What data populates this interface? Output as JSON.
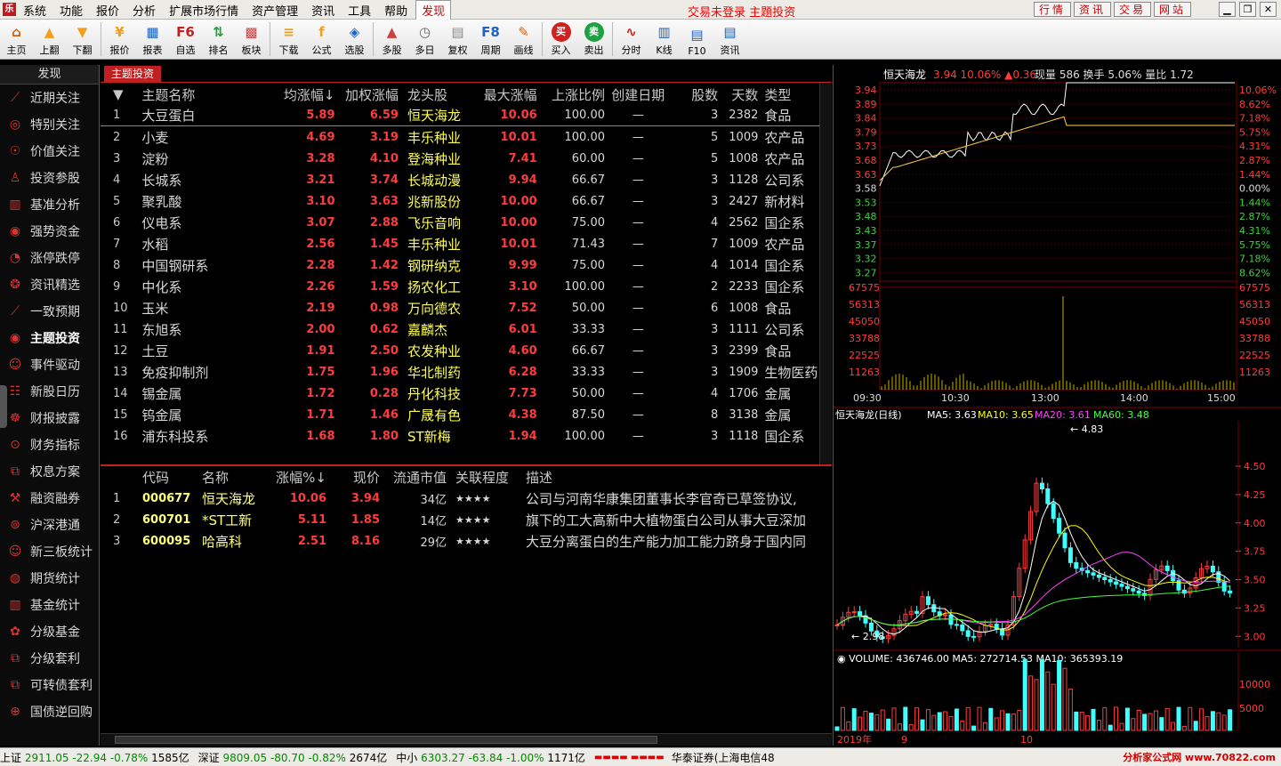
{
  "menubar": {
    "logo": "乐",
    "menus": [
      "系统",
      "功能",
      "报价",
      "分析",
      "扩展市场行情",
      "资产管理",
      "资讯",
      "工具",
      "帮助",
      "发现"
    ],
    "active_menu": "发现",
    "status": "交易未登录 主题投资",
    "quick": [
      "行情",
      "资讯",
      "交易",
      "网站"
    ]
  },
  "toolbar": [
    {
      "label": "主页",
      "icon": "home-icon",
      "color": "#d06010"
    },
    {
      "label": "上翻",
      "icon": "arrow-up-icon",
      "color": "#f0a020"
    },
    {
      "label": "下翻",
      "icon": "arrow-down-icon",
      "color": "#f0a020"
    },
    {
      "sep": true
    },
    {
      "label": "报价",
      "icon": "quote-icon",
      "color": "#f0a020"
    },
    {
      "label": "报表",
      "icon": "report-icon",
      "color": "#2060c0"
    },
    {
      "label": "自选",
      "icon": "f6-icon",
      "color": "#c02020"
    },
    {
      "label": "排名",
      "icon": "rank-icon",
      "color": "#20a040"
    },
    {
      "label": "板块",
      "icon": "sector-icon",
      "color": "#d04040"
    },
    {
      "sep": true
    },
    {
      "label": "下载",
      "icon": "download-icon",
      "color": "#f0a020"
    },
    {
      "label": "公式",
      "icon": "formula-icon",
      "color": "#f0a020"
    },
    {
      "label": "选股",
      "icon": "stock-pick-icon",
      "color": "#2060c0"
    },
    {
      "sep": true
    },
    {
      "label": "多股",
      "icon": "multi-stock-icon",
      "color": "#d04040"
    },
    {
      "label": "多日",
      "icon": "multi-day-icon",
      "color": "#666"
    },
    {
      "label": "复权",
      "icon": "adjust-icon",
      "color": "#888"
    },
    {
      "label": "周期",
      "icon": "f8-icon",
      "color": "#2060c0"
    },
    {
      "label": "画线",
      "icon": "draw-line-icon",
      "color": "#d06010"
    },
    {
      "sep": true
    },
    {
      "label": "买入",
      "icon": "buy-icon",
      "color": "#d02020"
    },
    {
      "label": "卖出",
      "icon": "sell-icon",
      "color": "#20a040"
    },
    {
      "sep": true
    },
    {
      "label": "分时",
      "icon": "timeshare-icon",
      "color": "#d02020"
    },
    {
      "label": "K线",
      "icon": "kline-icon",
      "color": "#2060c0"
    },
    {
      "label": "F10",
      "icon": "f10-icon",
      "color": "#2060c0"
    },
    {
      "label": "资讯",
      "icon": "news-icon",
      "color": "#2060c0"
    }
  ],
  "sidebar": {
    "title": "发现",
    "items": [
      {
        "label": "近期关注",
        "icon": "trend-icon"
      },
      {
        "label": "特别关注",
        "icon": "target-icon"
      },
      {
        "label": "价值关注",
        "icon": "value-icon"
      },
      {
        "label": "投资参股",
        "icon": "invest-icon"
      },
      {
        "label": "基准分析",
        "icon": "bar-chart-icon"
      },
      {
        "label": "强势资金",
        "icon": "money-icon"
      },
      {
        "label": "涨停跌停",
        "icon": "limit-icon"
      },
      {
        "label": "资讯精选",
        "icon": "news-select-icon"
      },
      {
        "label": "一致预期",
        "icon": "line-chart-icon"
      },
      {
        "label": "主题投资",
        "icon": "theme-icon",
        "active": true
      },
      {
        "label": "事件驱动",
        "icon": "event-icon"
      },
      {
        "label": "新股日历",
        "icon": "ipo-icon"
      },
      {
        "label": "财报披露",
        "icon": "report-disclose-icon"
      },
      {
        "label": "财务指标",
        "icon": "finance-icon"
      },
      {
        "label": "权息方案",
        "icon": "dividend-icon"
      },
      {
        "label": "融资融券",
        "icon": "margin-icon"
      },
      {
        "label": "沪深港通",
        "icon": "connect-icon"
      },
      {
        "label": "新三板统计",
        "icon": "neeq-icon"
      },
      {
        "label": "期货统计",
        "icon": "futures-icon"
      },
      {
        "label": "基金统计",
        "icon": "fund-icon"
      },
      {
        "label": "分级基金",
        "icon": "graded-fund-icon"
      },
      {
        "label": "分级套利",
        "icon": "arbitrage-icon"
      },
      {
        "label": "可转债套利",
        "icon": "convertible-icon"
      },
      {
        "label": "国债逆回购",
        "icon": "repo-icon"
      }
    ]
  },
  "tab": "主题投资",
  "themes": {
    "headers": [
      "",
      "主题名称",
      "均涨幅↓",
      "加权涨幅",
      "龙头股",
      "最大涨幅",
      "上涨比例",
      "创建日期",
      "股数",
      "天数",
      "类型"
    ],
    "rows": [
      [
        "1",
        "大豆蛋白",
        "5.89",
        "6.59",
        "恒天海龙",
        "10.06",
        "100.00",
        "—",
        "3",
        "2382",
        "食品"
      ],
      [
        "2",
        "小麦",
        "4.69",
        "3.19",
        "丰乐种业",
        "10.01",
        "100.00",
        "—",
        "5",
        "1009",
        "农产品"
      ],
      [
        "3",
        "淀粉",
        "3.28",
        "4.10",
        "登海种业",
        "7.41",
        "60.00",
        "—",
        "5",
        "1008",
        "农产品"
      ],
      [
        "4",
        "长城系",
        "3.21",
        "3.74",
        "长城动漫",
        "9.94",
        "66.67",
        "—",
        "3",
        "1128",
        "公司系"
      ],
      [
        "5",
        "聚乳酸",
        "3.10",
        "3.63",
        "兆新股份",
        "10.00",
        "66.67",
        "—",
        "3",
        "2427",
        "新材料"
      ],
      [
        "6",
        "仪电系",
        "3.07",
        "2.88",
        "飞乐音响",
        "10.00",
        "75.00",
        "—",
        "4",
        "2562",
        "国企系"
      ],
      [
        "7",
        "水稻",
        "2.56",
        "1.45",
        "丰乐种业",
        "10.01",
        "71.43",
        "—",
        "7",
        "1009",
        "农产品"
      ],
      [
        "8",
        "中国钢研系",
        "2.28",
        "1.42",
        "钢研纳克",
        "9.99",
        "75.00",
        "—",
        "4",
        "1014",
        "国企系"
      ],
      [
        "9",
        "中化系",
        "2.26",
        "1.59",
        "扬农化工",
        "3.10",
        "100.00",
        "—",
        "2",
        "2233",
        "国企系"
      ],
      [
        "10",
        "玉米",
        "2.19",
        "0.98",
        "万向德农",
        "7.52",
        "50.00",
        "—",
        "6",
        "1008",
        "食品"
      ],
      [
        "11",
        "东旭系",
        "2.00",
        "0.62",
        "嘉麟杰",
        "6.01",
        "33.33",
        "—",
        "3",
        "1111",
        "公司系"
      ],
      [
        "12",
        "土豆",
        "1.91",
        "2.50",
        "农发种业",
        "4.60",
        "66.67",
        "—",
        "3",
        "2399",
        "食品"
      ],
      [
        "13",
        "免疫抑制剂",
        "1.75",
        "1.96",
        "华北制药",
        "6.28",
        "33.33",
        "—",
        "3",
        "1909",
        "生物医药"
      ],
      [
        "14",
        "锡金属",
        "1.72",
        "0.28",
        "丹化科技",
        "7.73",
        "50.00",
        "—",
        "4",
        "1706",
        "金属"
      ],
      [
        "15",
        "钨金属",
        "1.71",
        "1.46",
        "广晟有色",
        "4.38",
        "87.50",
        "—",
        "8",
        "3138",
        "金属"
      ],
      [
        "16",
        "浦东科投系",
        "1.68",
        "1.80",
        "ST新梅",
        "1.94",
        "100.00",
        "—",
        "3",
        "1118",
        "国企系"
      ]
    ]
  },
  "stocks": {
    "headers": [
      "",
      "代码",
      "名称",
      "涨幅%↓",
      "现价",
      "流通市值",
      "关联程度",
      "描述"
    ],
    "rows": [
      [
        "1",
        "000677",
        "恒天海龙",
        "10.06",
        "3.94",
        "34亿",
        "★★★★",
        "公司与河南华康集团董事长李官奇已草签协议,"
      ],
      [
        "2",
        "600701",
        "*ST工新",
        "5.11",
        "1.85",
        "14亿",
        "★★★★",
        "旗下的工大高新中大植物蛋白公司从事大豆深加"
      ],
      [
        "3",
        "600095",
        "哈高科",
        "2.51",
        "8.16",
        "29亿",
        "★★★★",
        "大豆分离蛋白的生产能力加工能力跻身于国内同"
      ]
    ]
  },
  "intraday": {
    "header": {
      "name": "恒天海龙",
      "price": "3.94",
      "pct": "10.06%",
      "chg": "▲0.36",
      "vol_label": "现量",
      "vol": "586",
      "turn_label": "换手",
      "turn": "5.06%",
      "ratio_label": "量比",
      "ratio": "1.72"
    },
    "price_labels": [
      "3.94",
      "3.89",
      "3.84",
      "3.79",
      "3.73",
      "3.68",
      "3.63",
      "3.58",
      "3.53",
      "3.48",
      "3.43",
      "3.37",
      "3.32",
      "3.27"
    ],
    "pct_labels": [
      "10.06%",
      "8.62%",
      "7.18%",
      "5.75%",
      "4.31%",
      "2.87%",
      "1.44%",
      "0.00%",
      "1.44%",
      "2.87%",
      "4.31%",
      "5.75%",
      "7.18%",
      "8.62%"
    ],
    "vol_labels": [
      "67575",
      "56313",
      "45050",
      "33788",
      "22525",
      "11263"
    ],
    "time_labels": [
      "09:30",
      "10:30",
      "13:00",
      "14:00",
      "15:00"
    ]
  },
  "kline": {
    "header": {
      "title": "恒天海龙(日线)",
      "ma5": "MA5: 3.63",
      "ma10": "MA10: 3.65",
      "ma20": "MA20: 3.61",
      "ma60": "MA60: 3.48"
    },
    "price_labels": [
      "4.50",
      "4.25",
      "4.00",
      "3.75",
      "3.50",
      "3.25",
      "3.00"
    ],
    "high_label": "4.83",
    "low_label": "2.98",
    "volume_header": {
      "vol": "VOLUME: 436746.00",
      "ma5": "MA5: 272714.53",
      "ma10": "MA10: 365393.19"
    },
    "vol_labels": [
      "10000",
      "5000"
    ],
    "date_labels": [
      "2019年",
      "9",
      "10"
    ]
  },
  "statusbar": [
    {
      "name": "上证",
      "val": "2911.05",
      "chg": "-22.94",
      "pct": "-0.78%",
      "amt": "1585亿"
    },
    {
      "name": "深证",
      "val": "9809.05",
      "chg": "-80.70",
      "pct": "-0.82%",
      "amt": "2674亿"
    },
    {
      "name": "中小",
      "val": "6303.27",
      "chg": "-63.84",
      "pct": "-1.00%",
      "amt": "1171亿"
    }
  ],
  "broker": "华泰证券(上海电信48",
  "watermark": "分析家公式网 www.70822.com",
  "colors": {
    "up": "#ff3c3c",
    "leader": "#ffff55",
    "accent": "#c02020",
    "ma5": "#ffffff",
    "ma10": "#ffff00",
    "ma20": "#ff40ff",
    "ma60": "#40ff40"
  }
}
